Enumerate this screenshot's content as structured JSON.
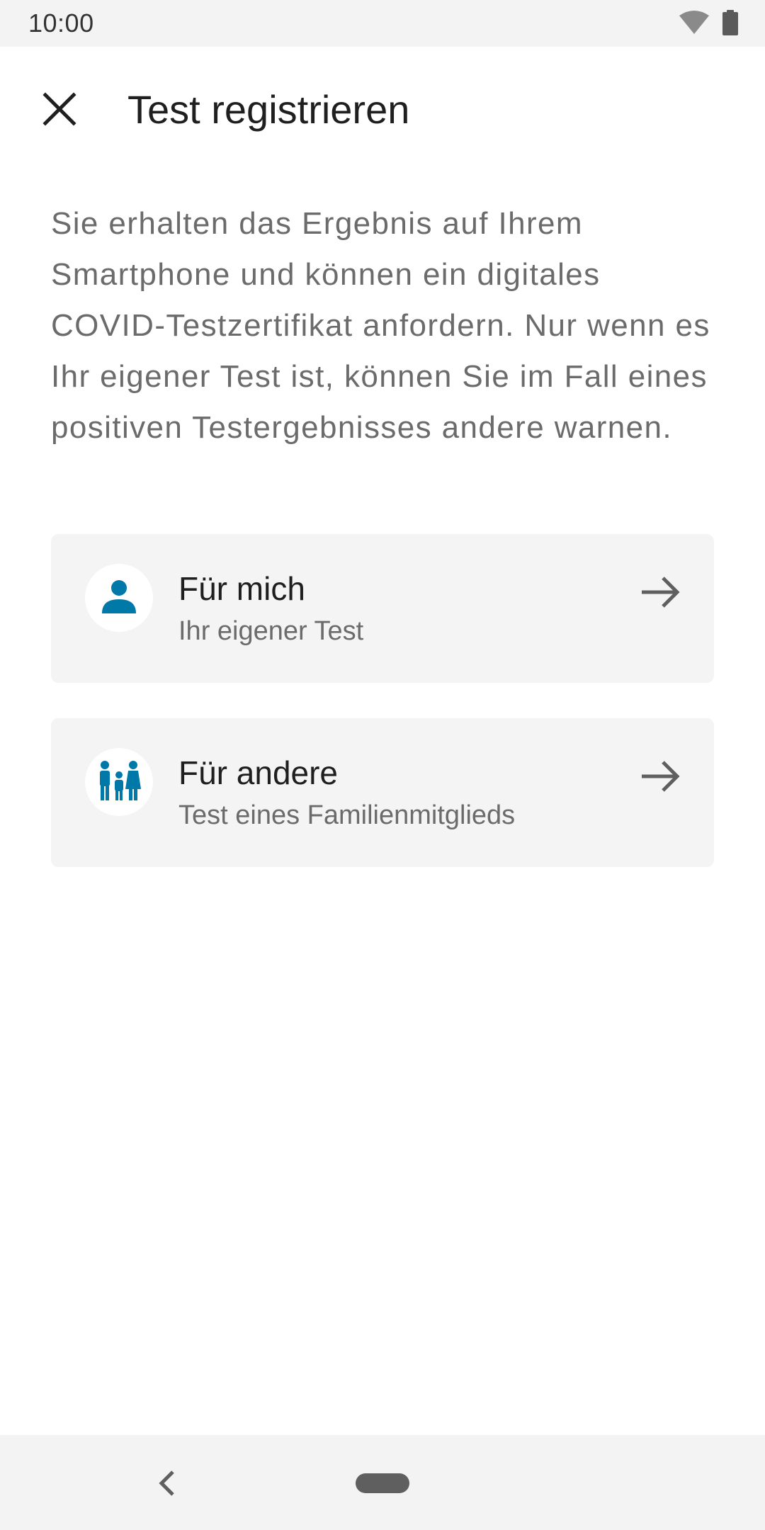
{
  "status_bar": {
    "time": "10:00",
    "icons": [
      "wifi-icon",
      "battery-icon"
    ]
  },
  "app_bar": {
    "close_icon": "close-icon",
    "title": "Test registrieren"
  },
  "description": "Sie erhalten das Ergebnis auf Ihrem Smartphone und können ein digitales COVID-Testzertifikat anfordern. Nur wenn es Ihr eigener Test ist, können Sie im Fall eines positiven Testergebnisses andere warnen.",
  "options": [
    {
      "icon": "person-icon",
      "title": "Für mich",
      "subtitle": "Ihr eigener Test",
      "arrow_icon": "arrow-right-icon"
    },
    {
      "icon": "family-icon",
      "title": "Für andere",
      "subtitle": "Test eines Familienmitglieds",
      "arrow_icon": "arrow-right-icon"
    }
  ],
  "nav_bar": {
    "back_icon": "back-chevron-icon",
    "home_icon": "home-pill-icon"
  },
  "colors": {
    "accent": "#0078a8",
    "title_text": "#1f1f1f",
    "secondary_text": "#6b6b6b",
    "card_background": "#f4f4f4",
    "system_bar": "#f3f3f3"
  }
}
